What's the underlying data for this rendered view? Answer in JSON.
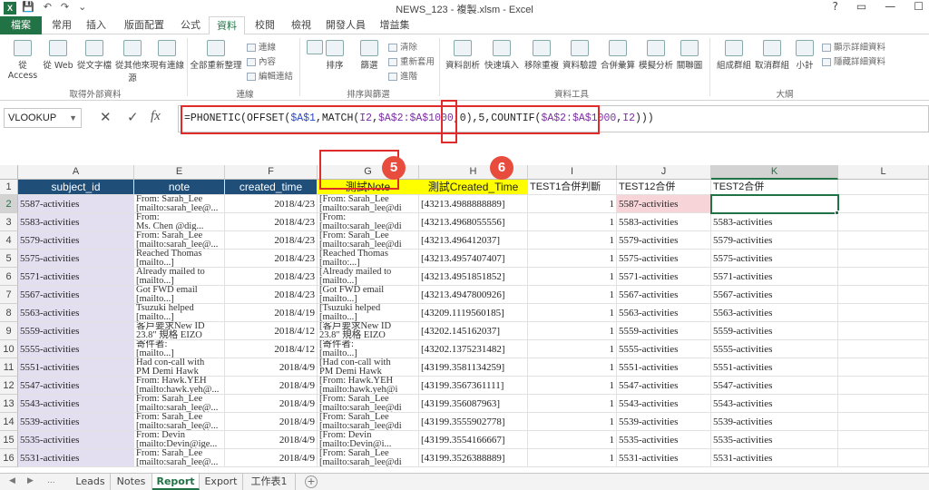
{
  "window": {
    "title": "NEWS_123 - 複製.xlsm - Excel",
    "logo": "X",
    "controls": [
      "?",
      "▭",
      "—",
      "☐"
    ]
  },
  "qat": [
    "💾",
    "↶",
    "↷",
    "⌄"
  ],
  "ribbon_tabs": {
    "file": "檔案",
    "items": [
      "常用",
      "插入",
      "版面配置",
      "公式",
      "資料",
      "校閱",
      "檢視",
      "開發人員",
      "增益集"
    ],
    "active": "資料"
  },
  "ribbon": {
    "buttons": {
      "from_access": "從 Access",
      "from_web": "從 Web",
      "from_text": "從文字檔",
      "from_other": "從其他來源",
      "existing": "現有連線",
      "refresh_all": "全部重新整理",
      "sort": "排序",
      "filter": "篩選",
      "text_to_col": "資料剖析",
      "flash_fill": "快速填入",
      "remove_dup": "移除重複",
      "validation": "資料驗證",
      "consolidate": "合併彙算",
      "what_if": "模擬分析",
      "relationships": "關聯圖",
      "group": "組成群組",
      "ungroup": "取消群組",
      "subtotal": "小計"
    },
    "small": {
      "connections": "連線",
      "properties": "內容",
      "edit_links": "編輯連結",
      "clear": "清除",
      "reapply": "重新套用",
      "advanced": "進階",
      "show_detail": "顯示詳細資料",
      "hide_detail": "隱藏詳細資料"
    },
    "groups": {
      "get_external": "取得外部資料",
      "connections": "連線",
      "sort_filter": "排序與篩選",
      "data_tools": "資料工具",
      "outline": "大綱"
    }
  },
  "formula_bar": {
    "name_box": "VLOOKUP",
    "cancel": "✕",
    "enter": "✓",
    "fx": "fx",
    "p1": "=PHONETIC(OFFSET(",
    "p2": "$A$1",
    "p3": ",MATCH(",
    "p4": "I2",
    "p5": ",",
    "p6": "$A$2:$A$1000",
    "p7": ",0)",
    "p8": ",5",
    "p9": ",COUNTIF(",
    "p10": "$A$2:$A$1000",
    "p11": ",",
    "p12": "I2",
    "p13": ")))"
  },
  "columns": [
    "A",
    "E",
    "F",
    "G",
    "H",
    "I",
    "J",
    "K",
    "L"
  ],
  "rows": [
    "1",
    "2",
    "3",
    "4",
    "5",
    "6",
    "7",
    "8",
    "9",
    "10",
    "11",
    "12",
    "13",
    "14",
    "15",
    "16"
  ],
  "headers": {
    "a": "subject_id",
    "e": "note",
    "f": "created_time",
    "g": "測試Note",
    "h": "測試Created_Time",
    "i": "TEST1合併判斷",
    "j": "TEST12合併",
    "k": "TEST2合併"
  },
  "data_rows": [
    {
      "a": "5587-activities",
      "e1": "From: Sarah_Lee",
      "e2": "[mailto:sarah_lee@...",
      "f": "2018/4/23",
      "g1": "[From: Sarah_Lee",
      "g2": "[mailto:sarah_lee@di",
      "h": "[43213.4988888889]",
      "i": "1",
      "j": "5587-activities",
      "k": ""
    },
    {
      "a": "5583-activities",
      "e1": "From:",
      "e2": "Ms. Chen @dig...",
      "f": "2018/4/23",
      "g1": "[From:",
      "g2": "[mailto:sarah_lee@di",
      "h": "[43213.4968055556]",
      "i": "1",
      "j": "5583-activities",
      "k": "5583-activities"
    },
    {
      "a": "5579-activities",
      "e1": "From: Sarah_Lee",
      "e2": "[mailto:sarah_lee@...",
      "f": "2018/4/23",
      "g1": "[From: Sarah_Lee",
      "g2": "[mailto:sarah_lee@di",
      "h": "[43213.496412037]",
      "i": "1",
      "j": "5579-activities",
      "k": "5579-activities"
    },
    {
      "a": "5575-activities",
      "e1": "Reached Thomas",
      "e2": "[mailto...]",
      "f": "2018/4/23",
      "g1": "[Reached Thomas",
      "g2": "[mailto:...]",
      "h": "[43213.4957407407]",
      "i": "1",
      "j": "5575-activities",
      "k": "5575-activities"
    },
    {
      "a": "5571-activities",
      "e1": "Already mailed to",
      "e2": "[mailto...]",
      "f": "2018/4/23",
      "g1": "[Already mailed to",
      "g2": "[mailto...]",
      "h": "[43213.4951851852]",
      "i": "1",
      "j": "5571-activities",
      "k": "5571-activities"
    },
    {
      "a": "5567-activities",
      "e1": "Got FWD email",
      "e2": "[mailto...]",
      "f": "2018/4/23",
      "g1": "[Got FWD email",
      "g2": "[mailto...]",
      "h": "[43213.4947800926]",
      "i": "1",
      "j": "5567-activities",
      "k": "5567-activities"
    },
    {
      "a": "5563-activities",
      "e1": "Tsuzuki helped",
      "e2": "[mailto...]",
      "f": "2018/4/19",
      "g1": "[Tsuzuki helped",
      "g2": "[mailto...]",
      "h": "[43209.1119560185]",
      "i": "1",
      "j": "5563-activities",
      "k": "5563-activities"
    },
    {
      "a": "5559-activities",
      "e1": "客戶要求New ID",
      "e2": "23.8\" 規格 EIZO",
      "f": "2018/4/12",
      "g1": "[客戶要求New ID",
      "g2": "23.8\" 規格 EIZO",
      "h": "[43202.145162037]",
      "i": "1",
      "j": "5559-activities",
      "k": "5559-activities"
    },
    {
      "a": "5555-activities",
      "e1": "寄件者:",
      "e2": "[mailto...]",
      "f": "2018/4/12",
      "g1": "[寄件者:",
      "g2": "[mailto...]",
      "h": "[43202.1375231482]",
      "i": "1",
      "j": "5555-activities",
      "k": "5555-activities"
    },
    {
      "a": "5551-activities",
      "e1": "Had con-call with",
      "e2": "PM Demi Hawk",
      "f": "2018/4/9",
      "g1": "[Had con-call with",
      "g2": "PM Demi Hawk",
      "h": "[43199.3581134259]",
      "i": "1",
      "j": "5551-activities",
      "k": "5551-activities"
    },
    {
      "a": "5547-activities",
      "e1": "From: Hawk.YEH",
      "e2": "[mailto:hawk.yeh@...",
      "f": "2018/4/9",
      "g1": "[From: Hawk.YEH",
      "g2": "[mailto:hawk.yeh@i",
      "h": "[43199.3567361111]",
      "i": "1",
      "j": "5547-activities",
      "k": "5547-activities"
    },
    {
      "a": "5543-activities",
      "e1": "From: Sarah_Lee",
      "e2": "[mailto:sarah_lee@...",
      "f": "2018/4/9",
      "g1": "[From: Sarah_Lee",
      "g2": "[mailto:sarah_lee@di",
      "h": "[43199.356087963]",
      "i": "1",
      "j": "5543-activities",
      "k": "5543-activities"
    },
    {
      "a": "5539-activities",
      "e1": "From: Sarah_Lee",
      "e2": "[mailto:sarah_lee@...",
      "f": "2018/4/9",
      "g1": "[From: Sarah_Lee",
      "g2": "[mailto:sarah_lee@di",
      "h": "[43199.3555902778]",
      "i": "1",
      "j": "5539-activities",
      "k": "5539-activities"
    },
    {
      "a": "5535-activities",
      "e1": "From: Devin",
      "e2": "[mailto:Devin@ige...",
      "f": "2018/4/9",
      "g1": "[From: Devin",
      "g2": "[mailto:Devin@i...",
      "h": "[43199.3554166667]",
      "i": "1",
      "j": "5535-activities",
      "k": "5535-activities"
    },
    {
      "a": "5531-activities",
      "e1": "From: Sarah_Lee",
      "e2": "[mailto:sarah_lee@...",
      "f": "2018/4/9",
      "g1": "[From: Sarah_Lee",
      "g2": "[mailto:sarah_lee@di",
      "h": "[43199.3526388889]",
      "i": "1",
      "j": "5531-activities",
      "k": "5531-activities"
    }
  ],
  "badges": {
    "five": "5",
    "six": "6"
  },
  "sheet_tabs": {
    "items": [
      "Leads",
      "Notes",
      "Report",
      "Export",
      "工作表1"
    ],
    "active": "Report",
    "add": "+",
    "nav_prev": "◀",
    "nav_next": "▶",
    "more": "..."
  },
  "colors": {
    "excel_green": "#217346",
    "header_blue": "#1f4e79",
    "header_yellow": "#ffff00",
    "subject_purple": "#e4dff0",
    "annotation_red": "#e02b2b"
  }
}
